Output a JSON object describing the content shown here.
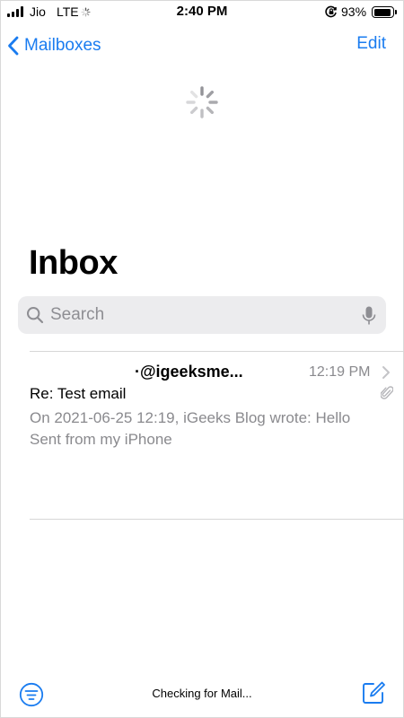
{
  "status_bar": {
    "carrier": "Jio",
    "network": "LTE",
    "time": "2:40 PM",
    "battery_percent": "93%",
    "battery_level": 0.93,
    "icons": [
      "signal-bars-icon",
      "activity-indicator-icon",
      "rotation-lock-icon",
      "battery-icon"
    ]
  },
  "nav": {
    "back_label": "Mailboxes",
    "edit_label": "Edit",
    "accent_color": "#1a7cf0"
  },
  "title": "Inbox",
  "search": {
    "placeholder": "Search"
  },
  "messages": [
    {
      "sender": "·@igeeksme...",
      "time": "12:19 PM",
      "subject": "Re: Test email",
      "preview": "On 2021-06-25 12:19, iGeeks Blog wrote: Hello\nSent from my iPhone",
      "has_attachment": true
    }
  ],
  "toolbar": {
    "status": "Checking for Mail...",
    "icons": [
      "filter-icon",
      "compose-icon"
    ]
  }
}
